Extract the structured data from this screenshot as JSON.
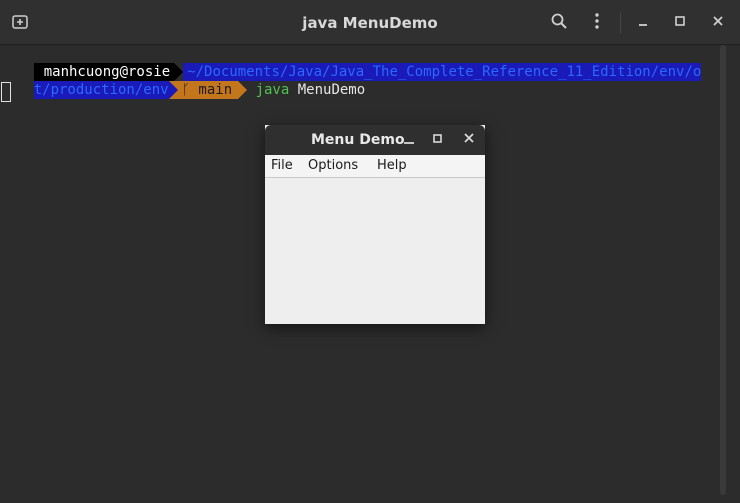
{
  "window": {
    "title": "java MenuDemo"
  },
  "prompt": {
    "user": "manhcuong@rosie",
    "path_line1": "~/Documents/Java/Java_The_Complete_Reference_11_Edition/env/o",
    "path_line2": "t/production/env",
    "branch_icon": "git-branch-icon",
    "branch": "main",
    "command": "java",
    "args": "MenuDemo"
  },
  "app": {
    "title": "Menu Demo",
    "menus": [
      "File",
      "Options",
      "Help"
    ]
  },
  "colors": {
    "path_bg": "#1a1ab8",
    "branch_bg": "#c4761c",
    "command": "#4ec24e"
  }
}
